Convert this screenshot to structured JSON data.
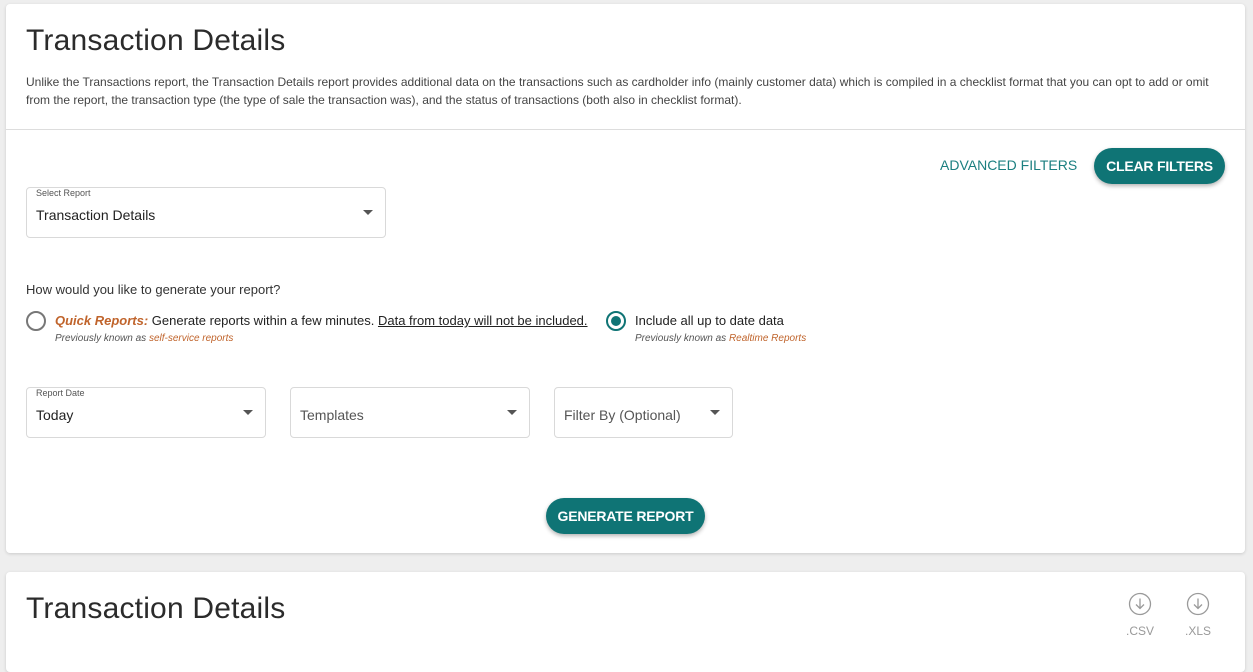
{
  "header": {
    "title": "Transaction Details",
    "description": "Unlike the Transactions report, the Transaction Details report provides additional data on the transactions such as cardholder info (mainly customer data) which is compiled in a checklist format that you can opt to add or omit from the report, the transaction type (the type of sale the transaction was), and the status of transactions (both also in checklist format)."
  },
  "actions": {
    "advanced_filters": "ADVANCED FILTERS",
    "clear_filters": "CLEAR FILTERS",
    "generate_report": "GENERATE REPORT"
  },
  "select_report": {
    "label": "Select Report",
    "value": "Transaction Details"
  },
  "generation": {
    "question": "How would you like to generate your report?",
    "quick": {
      "label": "Quick Reports:",
      "text": " Generate reports within a few minutes. ",
      "link": "Data from today will not be included.",
      "sub_prefix": "Previously known as ",
      "sub_accent": "self-service reports",
      "selected": false
    },
    "realtime": {
      "text": "Include all up to date data",
      "sub_prefix": "Previously known as ",
      "sub_accent": "Realtime Reports",
      "selected": true
    }
  },
  "filters": {
    "report_date": {
      "label": "Report Date",
      "value": "Today"
    },
    "templates": {
      "placeholder": "Templates"
    },
    "filter_by": {
      "placeholder": "Filter By (Optional)"
    }
  },
  "results": {
    "title": "Transaction Details",
    "downloads": [
      {
        "label": ".CSV",
        "icon": "download-circle-icon"
      },
      {
        "label": ".XLS",
        "icon": "download-circle-icon"
      }
    ]
  },
  "colors": {
    "primary": "#0f7475",
    "link": "#1b7f80",
    "accent": "#c0642c",
    "background": "#eeeeee"
  }
}
